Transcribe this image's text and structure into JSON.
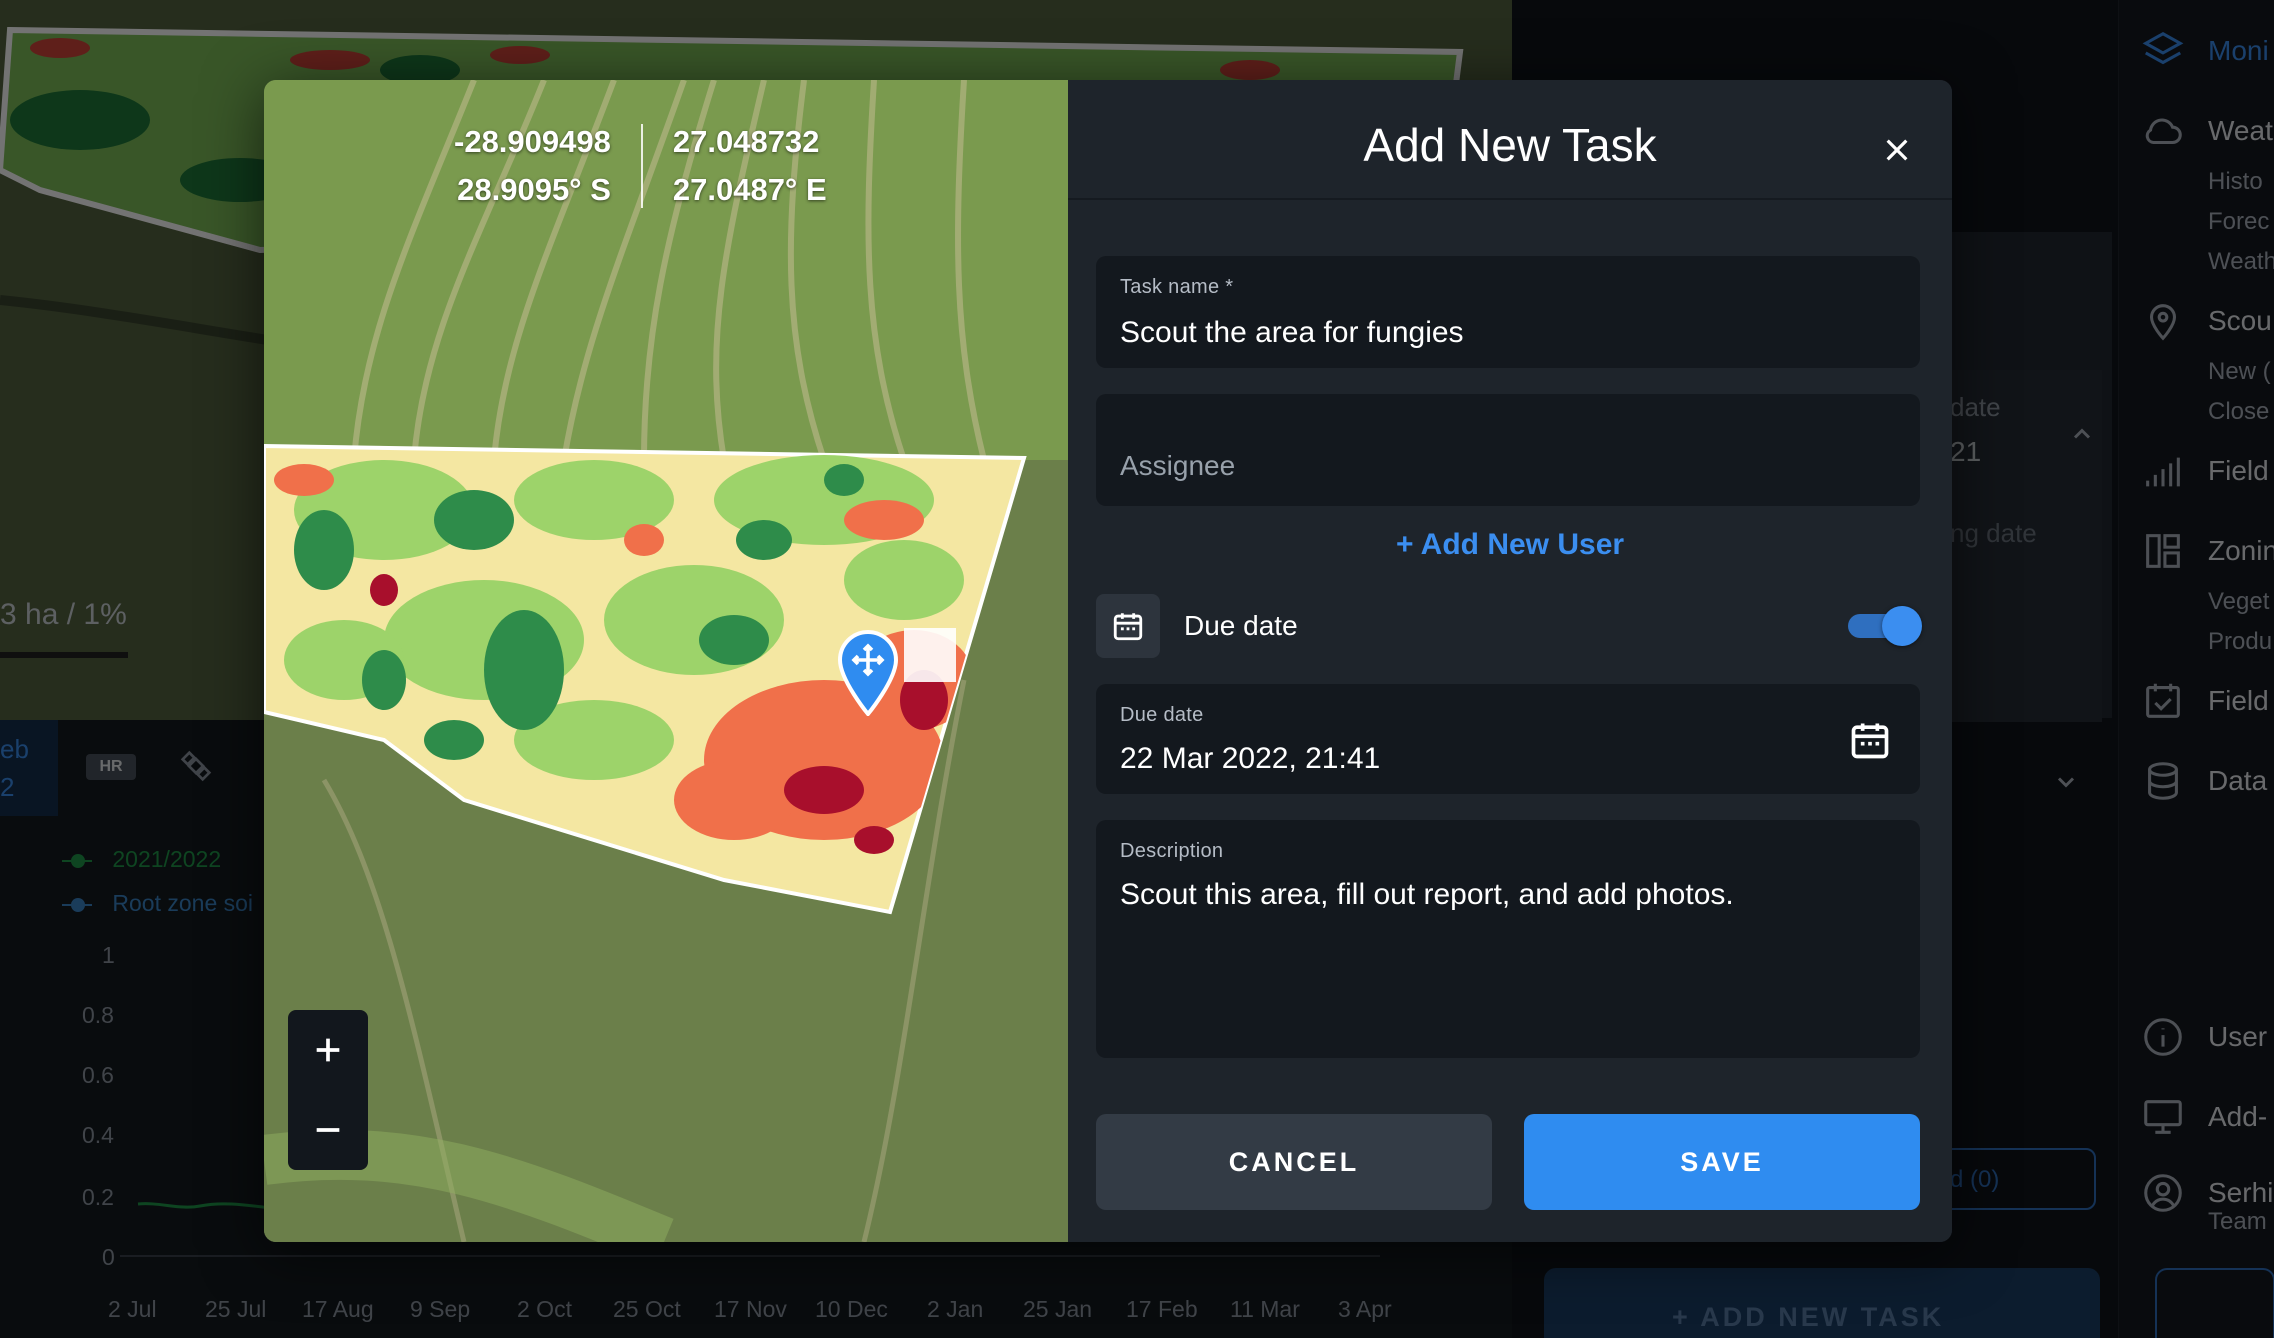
{
  "background": {
    "area_stat": "3 ha / 1%",
    "hr_badge": "HR",
    "tab_partial_1": "eb",
    "tab_partial_2": "2",
    "legend": [
      {
        "label": "2021/2022",
        "color": "#1f9a4a"
      },
      {
        "label": "Root zone soi",
        "color": "#3a86c8"
      }
    ],
    "y_ticks": [
      "1",
      "0.8",
      "0.6",
      "0.4",
      "0.2",
      "0"
    ],
    "x_dates": [
      "2 Jul",
      "25 Jul",
      "17 Aug",
      "9 Sep",
      "2 Oct",
      "25 Oct",
      "17 Nov",
      "10 Dec",
      "2 Jan",
      "25 Jan",
      "17 Feb",
      "11 Mar",
      "3 Apr"
    ],
    "right_panel": {
      "date_label": "date",
      "date_value": "21",
      "ending_date": "ng date",
      "tasks_link": "d (0)",
      "add_task_label": "ADD NEW TASK"
    }
  },
  "sidebar": {
    "monitoring": "Moni",
    "weather": "Weat",
    "weather_sub": [
      "Histo",
      "Forec",
      "Weath"
    ],
    "scouting": "Scou",
    "scouting_sub": [
      "New (",
      "Close"
    ],
    "field1": "Field",
    "zoning": "Zonin",
    "zoning_sub": [
      "Veget",
      "Produ"
    ],
    "field2": "Field",
    "data": "Data",
    "user": "User",
    "addons": "Add-",
    "account_name": "Serhi",
    "account_team": "Team"
  },
  "modal": {
    "coords": {
      "lat_decimal": "-28.909498",
      "lat_dms": "28.9095° S",
      "lng_decimal": "27.048732",
      "lng_dms": "27.0487° E"
    },
    "title": "Add New Task",
    "task_name_label": "Task name *",
    "task_name_value": "Scout the area for fungies",
    "assignee_placeholder": "Assignee",
    "add_user_label": "+ Add New User",
    "due_toggle_label": "Due date",
    "due_toggle_on": true,
    "due_date_label": "Due date",
    "due_date_value": "22 Mar 2022, 21:41",
    "description_label": "Description",
    "description_value": "Scout this area, fill out report, and add photos.",
    "cancel_label": "CANCEL",
    "save_label": "SAVE",
    "accent_color": "#2f8cf0"
  }
}
